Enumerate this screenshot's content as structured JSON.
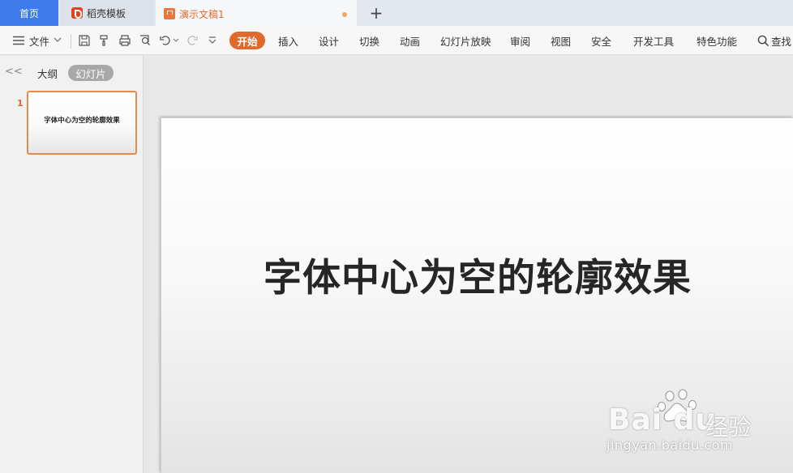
{
  "tabs": {
    "home": "首页",
    "daoke": "稻壳模板",
    "doc": "演示文稿1",
    "add": "+"
  },
  "toolbar": {
    "file": "文件",
    "menus": [
      "开始",
      "插入",
      "设计",
      "切换",
      "动画",
      "幻灯片放映",
      "审阅",
      "视图",
      "安全",
      "开发工具",
      "特色功能"
    ],
    "search": "查找"
  },
  "panel": {
    "collapse": "<<",
    "outline": "大纲",
    "slides": "幻灯片",
    "slide_number": "1",
    "thumb_title": "字体中心为空的轮廓效果"
  },
  "slide": {
    "title": "字体中心为空的轮廓效果"
  },
  "watermark": {
    "brand": "Bai du",
    "jingyan": "经验",
    "url": "jingyan.baidu.com"
  },
  "colors": {
    "accent": "#e0692e",
    "home_tab": "#3d7be8"
  }
}
